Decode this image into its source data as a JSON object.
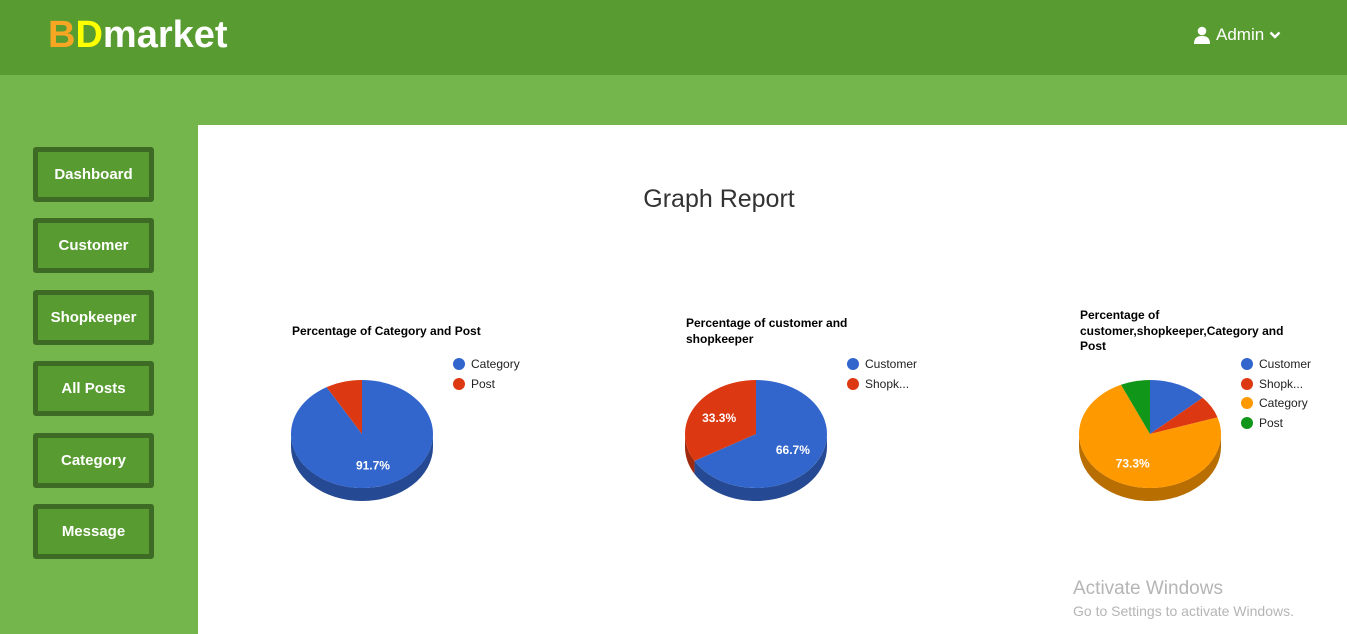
{
  "header": {
    "logo": {
      "part1": "B",
      "part2": "D",
      "part3": "market"
    },
    "user": {
      "label": "Admin"
    }
  },
  "sidebar": {
    "items": [
      {
        "label": "Dashboard"
      },
      {
        "label": "Customer"
      },
      {
        "label": "Shopkeeper"
      },
      {
        "label": "All Posts"
      },
      {
        "label": "Category"
      },
      {
        "label": "Message"
      }
    ]
  },
  "main": {
    "title": "Graph Report"
  },
  "colors": {
    "header_bg": "#589b30",
    "page_bg": "#74b54c",
    "button_bg": "#589b30",
    "button_border": "#3d6b25",
    "content_bg": "#ffffff",
    "blue": "#3366cc",
    "red": "#dc3912",
    "orange": "#ff9900",
    "green": "#109618"
  },
  "chart_data": [
    {
      "type": "pie",
      "title": "Percentage of Category and Post",
      "title_lines": [
        "Percentage of Category and Post"
      ],
      "slices": [
        {
          "name": "Category",
          "value": 91.7,
          "color": "#3366cc",
          "label": "91.7%"
        },
        {
          "name": "Post",
          "value": 8.3,
          "color": "#dc3912",
          "label": ""
        }
      ]
    },
    {
      "type": "pie",
      "title": "Percentage of customer and shopkeeper",
      "title_lines": [
        "Percentage of customer and",
        "shopkeeper"
      ],
      "slices": [
        {
          "name": "Customer",
          "value": 66.7,
          "color": "#3366cc",
          "label": "66.7%"
        },
        {
          "name": "Shopk...",
          "value": 33.3,
          "color": "#dc3912",
          "label": "33.3%"
        }
      ]
    },
    {
      "type": "pie",
      "title": "Percentage of customer,shopkeeper,Category and Post",
      "title_lines": [
        "Percentage of",
        "customer,shopkeeper,Category and",
        "Post"
      ],
      "slices": [
        {
          "name": "Customer",
          "value": 13.3,
          "color": "#3366cc",
          "label": ""
        },
        {
          "name": "Shopk...",
          "value": 6.7,
          "color": "#dc3912",
          "label": ""
        },
        {
          "name": "Category",
          "value": 73.3,
          "color": "#ff9900",
          "label": "73.3%"
        },
        {
          "name": "Post",
          "value": 6.7,
          "color": "#109618",
          "label": ""
        }
      ]
    }
  ],
  "watermark": {
    "line1": "Activate Windows",
    "line2": "Go to Settings to activate Windows."
  }
}
